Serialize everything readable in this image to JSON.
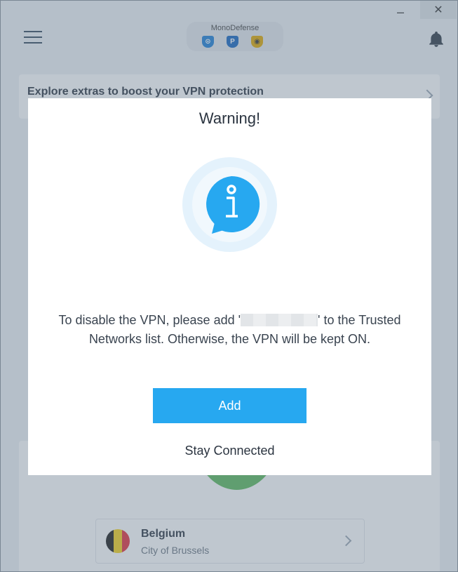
{
  "app": {
    "name": "MonoDefense",
    "icons": [
      "vpn-shield-icon",
      "privacy-shield-icon",
      "mask-shield-icon"
    ],
    "bi_glyphs": [
      "⊙",
      "P",
      "◉"
    ]
  },
  "window_controls": {
    "minimize": "–",
    "close": "✕"
  },
  "promo": {
    "text": "Explore extras to boost your VPN protection"
  },
  "location": {
    "country": "Belgium",
    "city": "City of Brussels",
    "flag_colors": [
      "#1a1a1a",
      "#f6d21a",
      "#e3303b"
    ]
  },
  "dialog": {
    "title": "Warning!",
    "message_before": "To disable the VPN, please add '",
    "message_after": "' to the Trusted Networks list. Otherwise, the VPN will be kept ON.",
    "add_label": "Add",
    "stay_label": "Stay Connected"
  },
  "colors": {
    "accent": "#27a8f0",
    "connected_green": "#5cb85c"
  }
}
